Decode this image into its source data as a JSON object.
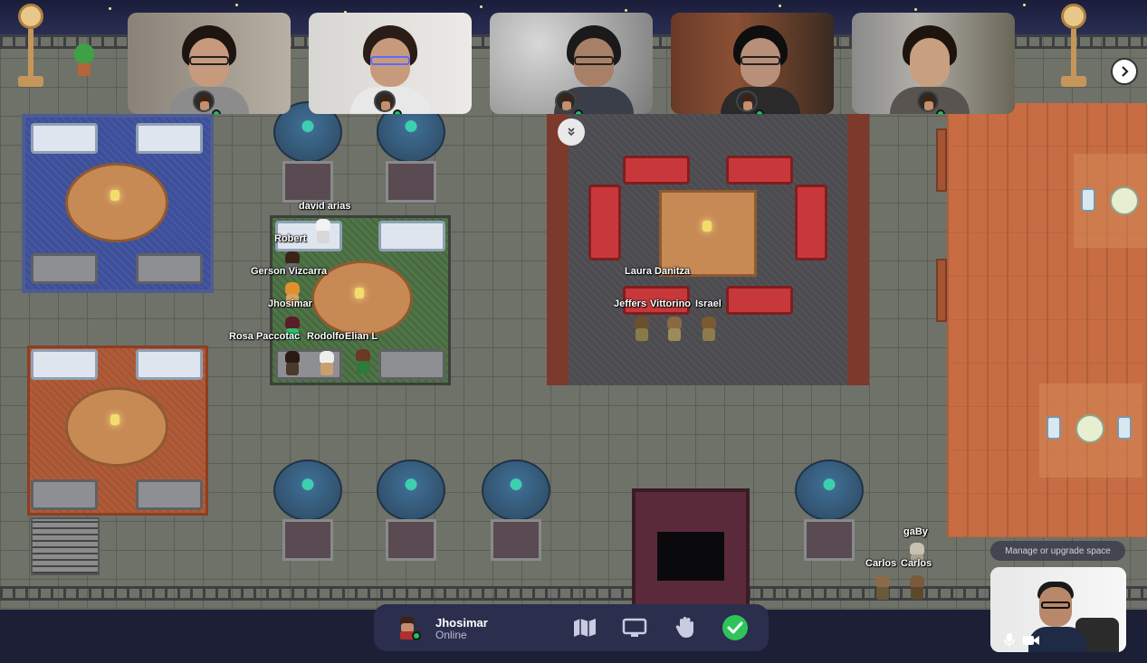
{
  "video_tiles": [
    {
      "name": "participant-1",
      "online": true
    },
    {
      "name": "participant-2",
      "online": true
    },
    {
      "name": "participant-3",
      "online": true
    },
    {
      "name": "participant-4",
      "online": true
    },
    {
      "name": "participant-5",
      "online": true
    }
  ],
  "map_labels": {
    "david_arias": "david arias",
    "robert": "Robert",
    "gerson": "Gerson Vizcarra",
    "jhosimar": "Jhosimar",
    "rosa": "Rosa Paccotac",
    "rodolfo": "Rodolfo",
    "elian": "Elian L",
    "laura": "Laura Danitza",
    "jefferson": "Jeffers",
    "vittorino": "Vittorino",
    "israel": "Israel",
    "gaby": "gaBy",
    "carlos": "Carlos",
    "carlos2": "Carlos"
  },
  "bottom_bar": {
    "user_name": "Jhosimar",
    "user_status": "Online",
    "icons": [
      "map-icon",
      "screen-share-icon",
      "raise-hand-icon",
      "status-check-icon"
    ]
  },
  "upgrade_label": "Manage or upgrade space",
  "colors": {
    "online": "#21c25e",
    "bar_bg": "#2b2f4d",
    "check_green": "#2ec45a",
    "lounge_red": "#c8383a"
  }
}
